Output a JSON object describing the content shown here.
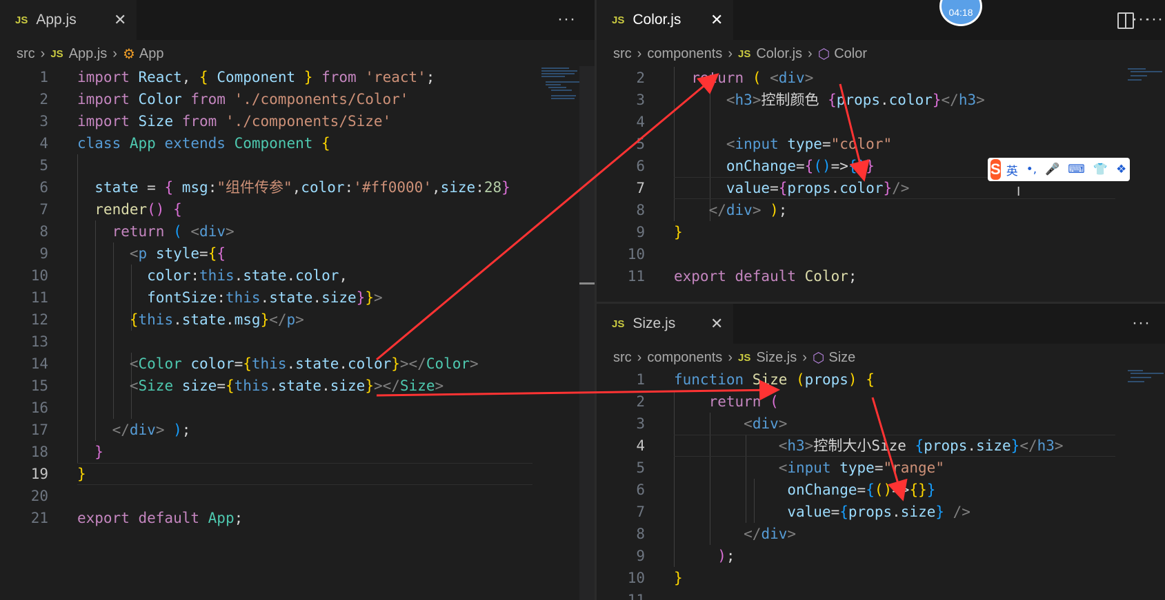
{
  "left": {
    "tab": {
      "label": "App.js",
      "icon_text": "JS",
      "close": "✕"
    },
    "more": "···",
    "breadcrumb": [
      "src",
      "App.js",
      "App"
    ],
    "breadcrumb_icon_text": "JS",
    "lines": [
      {
        "n": "1",
        "segs": [
          [
            "k",
            "import "
          ],
          [
            "v",
            "React"
          ],
          [
            "p",
            ", "
          ],
          [
            "b1",
            "{ "
          ],
          [
            "v",
            "Component "
          ],
          [
            "b1",
            "} "
          ],
          [
            "k",
            "from "
          ],
          [
            "s",
            "'react'"
          ],
          [
            "p",
            ";"
          ]
        ]
      },
      {
        "n": "2",
        "segs": [
          [
            "k",
            "import "
          ],
          [
            "v",
            "Color "
          ],
          [
            "k",
            "from "
          ],
          [
            "s",
            "'./components/Color'"
          ]
        ]
      },
      {
        "n": "3",
        "segs": [
          [
            "k",
            "import "
          ],
          [
            "v",
            "Size "
          ],
          [
            "k",
            "from "
          ],
          [
            "s",
            "'./components/Size'"
          ]
        ]
      },
      {
        "n": "4",
        "segs": [
          [
            "kb",
            "class "
          ],
          [
            "cls",
            "App "
          ],
          [
            "kb",
            "extends "
          ],
          [
            "cls",
            "Component "
          ],
          [
            "b1",
            "{"
          ]
        ]
      },
      {
        "n": "5",
        "segs": []
      },
      {
        "n": "6",
        "segs": [
          [
            "p",
            "  "
          ],
          [
            "v",
            "state "
          ],
          [
            "p",
            "= "
          ],
          [
            "b2",
            "{ "
          ],
          [
            "v",
            "msg"
          ],
          [
            "p",
            ":"
          ],
          [
            "s",
            "\"组件传参\""
          ],
          [
            "p",
            ","
          ],
          [
            "v",
            "color"
          ],
          [
            "p",
            ":"
          ],
          [
            "s",
            "'#ff0000'"
          ],
          [
            "p",
            ","
          ],
          [
            "v",
            "size"
          ],
          [
            "p",
            ":"
          ],
          [
            "n",
            "28"
          ],
          [
            "b2",
            "}"
          ]
        ]
      },
      {
        "n": "7",
        "segs": [
          [
            "p",
            "  "
          ],
          [
            "fn",
            "render"
          ],
          [
            "b2",
            "() "
          ],
          [
            "b2",
            "{"
          ]
        ]
      },
      {
        "n": "8",
        "segs": [
          [
            "p",
            "    "
          ],
          [
            "k",
            "return "
          ],
          [
            "b3",
            "( "
          ],
          [
            "t",
            "<"
          ],
          [
            "tg",
            "div"
          ],
          [
            "t",
            ">"
          ]
        ]
      },
      {
        "n": "9",
        "segs": [
          [
            "p",
            "      "
          ],
          [
            "t",
            "<"
          ],
          [
            "tg",
            "p "
          ],
          [
            "v",
            "style"
          ],
          [
            "p",
            "="
          ],
          [
            "b1",
            "{"
          ],
          [
            "b2",
            "{"
          ]
        ]
      },
      {
        "n": "10",
        "segs": [
          [
            "p",
            "        "
          ],
          [
            "v",
            "color"
          ],
          [
            "p",
            ":"
          ],
          [
            "kb",
            "this"
          ],
          [
            "p",
            "."
          ],
          [
            "v",
            "state"
          ],
          [
            "p",
            "."
          ],
          [
            "v",
            "color"
          ],
          [
            "p",
            ","
          ]
        ]
      },
      {
        "n": "11",
        "segs": [
          [
            "p",
            "        "
          ],
          [
            "v",
            "fontSize"
          ],
          [
            "p",
            ":"
          ],
          [
            "kb",
            "this"
          ],
          [
            "p",
            "."
          ],
          [
            "v",
            "state"
          ],
          [
            "p",
            "."
          ],
          [
            "v",
            "size"
          ],
          [
            "b2",
            "}"
          ],
          [
            "b1",
            "}"
          ],
          [
            "t",
            ">"
          ]
        ]
      },
      {
        "n": "12",
        "segs": [
          [
            "p",
            "      "
          ],
          [
            "b1",
            "{"
          ],
          [
            "kb",
            "this"
          ],
          [
            "p",
            "."
          ],
          [
            "v",
            "state"
          ],
          [
            "p",
            "."
          ],
          [
            "v",
            "msg"
          ],
          [
            "b1",
            "}"
          ],
          [
            "t",
            "</"
          ],
          [
            "tg",
            "p"
          ],
          [
            "t",
            ">"
          ]
        ]
      },
      {
        "n": "13",
        "segs": []
      },
      {
        "n": "14",
        "segs": [
          [
            "p",
            "      "
          ],
          [
            "t",
            "<"
          ],
          [
            "cls",
            "Color "
          ],
          [
            "v",
            "color"
          ],
          [
            "p",
            "="
          ],
          [
            "b1",
            "{"
          ],
          [
            "kb",
            "this"
          ],
          [
            "p",
            "."
          ],
          [
            "v",
            "state"
          ],
          [
            "p",
            "."
          ],
          [
            "v",
            "color"
          ],
          [
            "b1",
            "}"
          ],
          [
            "t",
            "></"
          ],
          [
            "cls",
            "Color"
          ],
          [
            "t",
            ">"
          ]
        ]
      },
      {
        "n": "15",
        "segs": [
          [
            "p",
            "      "
          ],
          [
            "t",
            "<"
          ],
          [
            "cls",
            "Size "
          ],
          [
            "v",
            "size"
          ],
          [
            "p",
            "="
          ],
          [
            "b1",
            "{"
          ],
          [
            "kb",
            "this"
          ],
          [
            "p",
            "."
          ],
          [
            "v",
            "state"
          ],
          [
            "p",
            "."
          ],
          [
            "v",
            "size"
          ],
          [
            "b1",
            "}"
          ],
          [
            "t",
            "></"
          ],
          [
            "cls",
            "Size"
          ],
          [
            "t",
            ">"
          ]
        ]
      },
      {
        "n": "16",
        "segs": []
      },
      {
        "n": "17",
        "segs": [
          [
            "p",
            "    "
          ],
          [
            "t",
            "</"
          ],
          [
            "tg",
            "div"
          ],
          [
            "t",
            "> "
          ],
          [
            "b3",
            ")"
          ],
          [
            "p",
            ";"
          ]
        ]
      },
      {
        "n": "18",
        "segs": [
          [
            "p",
            "  "
          ],
          [
            "b2",
            "}"
          ]
        ]
      },
      {
        "n": "19",
        "segs": [
          [
            "b1",
            "}"
          ]
        ]
      },
      {
        "n": "20",
        "segs": []
      },
      {
        "n": "21",
        "segs": [
          [
            "k",
            "export default "
          ],
          [
            "cls",
            "App"
          ],
          [
            "p",
            ";"
          ]
        ]
      }
    ]
  },
  "top_right": {
    "tab": {
      "label": "Color.js",
      "icon_text": "JS",
      "close": "✕"
    },
    "more": "···",
    "breadcrumb": [
      "src",
      "components",
      "Color.js",
      "Color"
    ],
    "breadcrumb_icon_text": "JS",
    "lines": [
      {
        "n": "2",
        "segs": [
          [
            "p",
            "  "
          ],
          [
            "k",
            "return "
          ],
          [
            "b1",
            "( "
          ],
          [
            "t",
            "<"
          ],
          [
            "tg",
            "div"
          ],
          [
            "t",
            ">"
          ]
        ]
      },
      {
        "n": "3",
        "segs": [
          [
            "p",
            "      "
          ],
          [
            "t",
            "<"
          ],
          [
            "tg",
            "h3"
          ],
          [
            "t",
            ">"
          ],
          [
            "p",
            "控制颜色 "
          ],
          [
            "b2",
            "{"
          ],
          [
            "v",
            "props"
          ],
          [
            "p",
            "."
          ],
          [
            "v",
            "color"
          ],
          [
            "b2",
            "}"
          ],
          [
            "t",
            "</"
          ],
          [
            "tg",
            "h3"
          ],
          [
            "t",
            ">"
          ]
        ]
      },
      {
        "n": "4",
        "segs": []
      },
      {
        "n": "5",
        "segs": [
          [
            "p",
            "      "
          ],
          [
            "t",
            "<"
          ],
          [
            "tg",
            "input "
          ],
          [
            "v",
            "type"
          ],
          [
            "p",
            "="
          ],
          [
            "s",
            "\"color\""
          ]
        ]
      },
      {
        "n": "6",
        "segs": [
          [
            "p",
            "      "
          ],
          [
            "v",
            "onChange"
          ],
          [
            "p",
            "="
          ],
          [
            "b2",
            "{"
          ],
          [
            "b3",
            "()"
          ],
          [
            "p",
            "=>"
          ],
          [
            "b3",
            "{}"
          ],
          [
            "b2",
            "}"
          ]
        ]
      },
      {
        "n": "7",
        "segs": [
          [
            "p",
            "      "
          ],
          [
            "v",
            "value"
          ],
          [
            "p",
            "="
          ],
          [
            "b2",
            "{"
          ],
          [
            "v",
            "props"
          ],
          [
            "p",
            "."
          ],
          [
            "v",
            "color"
          ],
          [
            "b2",
            "}"
          ],
          [
            "t",
            "/>"
          ]
        ]
      },
      {
        "n": "8",
        "segs": [
          [
            "p",
            "    "
          ],
          [
            "t",
            "</"
          ],
          [
            "tg",
            "div"
          ],
          [
            "t",
            "> "
          ],
          [
            "b1",
            ")"
          ],
          [
            "p",
            ";"
          ]
        ]
      },
      {
        "n": "9",
        "segs": [
          [
            "b1",
            "}"
          ]
        ]
      },
      {
        "n": "10",
        "segs": []
      },
      {
        "n": "11",
        "segs": [
          [
            "k",
            "export default "
          ],
          [
            "fn",
            "Color"
          ],
          [
            "p",
            ";"
          ]
        ]
      }
    ]
  },
  "bottom_right": {
    "tab": {
      "label": "Size.js",
      "icon_text": "JS",
      "close": "✕"
    },
    "more": "···",
    "breadcrumb": [
      "src",
      "components",
      "Size.js",
      "Size"
    ],
    "breadcrumb_icon_text": "JS",
    "lines": [
      {
        "n": "1",
        "segs": [
          [
            "kb",
            "function "
          ],
          [
            "fn",
            "Size "
          ],
          [
            "b1",
            "("
          ],
          [
            "v",
            "props"
          ],
          [
            "b1",
            ") "
          ],
          [
            "b1",
            "{"
          ]
        ]
      },
      {
        "n": "2",
        "segs": [
          [
            "p",
            "    "
          ],
          [
            "k",
            "return "
          ],
          [
            "b2",
            "("
          ]
        ]
      },
      {
        "n": "3",
        "segs": [
          [
            "p",
            "        "
          ],
          [
            "t",
            "<"
          ],
          [
            "tg",
            "div"
          ],
          [
            "t",
            ">"
          ]
        ]
      },
      {
        "n": "4",
        "segs": [
          [
            "p",
            "            "
          ],
          [
            "t",
            "<"
          ],
          [
            "tg",
            "h3"
          ],
          [
            "t",
            ">"
          ],
          [
            "p",
            "控制大小Size "
          ],
          [
            "b3",
            "{"
          ],
          [
            "v",
            "props"
          ],
          [
            "p",
            "."
          ],
          [
            "v",
            "size"
          ],
          [
            "b3",
            "}"
          ],
          [
            "t",
            "</"
          ],
          [
            "tg",
            "h3"
          ],
          [
            "t",
            ">"
          ]
        ]
      },
      {
        "n": "5",
        "segs": [
          [
            "p",
            "            "
          ],
          [
            "t",
            "<"
          ],
          [
            "tg",
            "input "
          ],
          [
            "v",
            "type"
          ],
          [
            "p",
            "="
          ],
          [
            "s",
            "\"range\""
          ]
        ]
      },
      {
        "n": "6",
        "segs": [
          [
            "p",
            "             "
          ],
          [
            "v",
            "onChange"
          ],
          [
            "p",
            "="
          ],
          [
            "b3",
            "{"
          ],
          [
            "b1",
            "()"
          ],
          [
            "p",
            "=>"
          ],
          [
            "b1",
            "{}"
          ],
          [
            "b3",
            "}"
          ]
        ]
      },
      {
        "n": "7",
        "segs": [
          [
            "p",
            "             "
          ],
          [
            "v",
            "value"
          ],
          [
            "p",
            "="
          ],
          [
            "b3",
            "{"
          ],
          [
            "v",
            "props"
          ],
          [
            "p",
            "."
          ],
          [
            "v",
            "size"
          ],
          [
            "b3",
            "} "
          ],
          [
            "t",
            "/>"
          ]
        ]
      },
      {
        "n": "8",
        "segs": [
          [
            "p",
            "        "
          ],
          [
            "t",
            "</"
          ],
          [
            "tg",
            "div"
          ],
          [
            "t",
            ">"
          ]
        ]
      },
      {
        "n": "9",
        "segs": [
          [
            "p",
            "     "
          ],
          [
            "b2",
            ")"
          ],
          [
            "p",
            ";"
          ]
        ]
      },
      {
        "n": "10",
        "segs": [
          [
            "b1",
            "}"
          ]
        ]
      },
      {
        "n": "11",
        "segs": []
      }
    ]
  },
  "timer_badge": "04:18",
  "ime_toolbar": {
    "label": "英",
    "glyphs": [
      "•,",
      "🎤",
      "⌨",
      "👕",
      "❖"
    ],
    "logo": "S"
  },
  "cursor_glyph": "I",
  "colors": {
    "annotation_arrow": "#ff3333",
    "editor_bg": "#1e1e1e",
    "tabbar_bg": "#181818"
  }
}
